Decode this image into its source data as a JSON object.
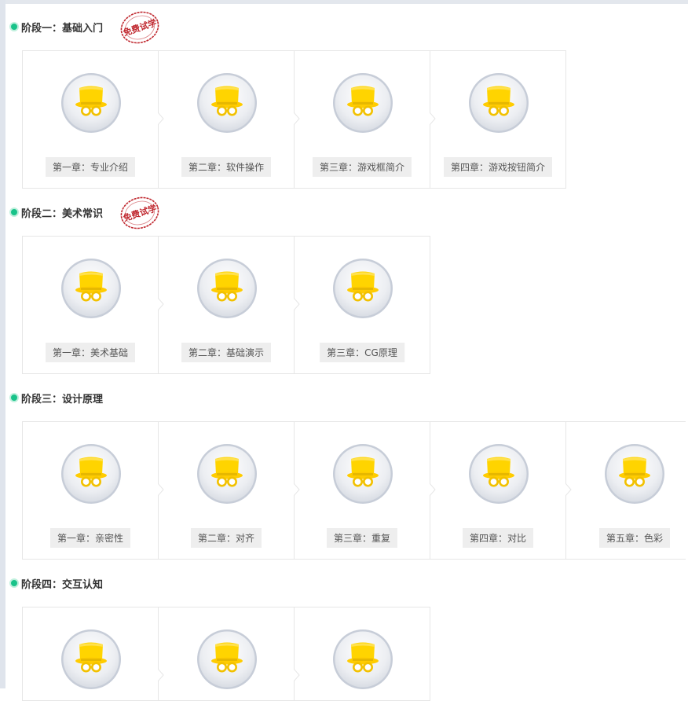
{
  "stamp_text": "免费试学",
  "stages": [
    {
      "title": "阶段一：基础入门",
      "free_trial": true,
      "chapters": [
        {
          "label": "第一章：专业介绍"
        },
        {
          "label": "第二章：软件操作"
        },
        {
          "label": "第三章：游戏框简介"
        },
        {
          "label": "第四章：游戏按钮简介"
        }
      ]
    },
    {
      "title": "阶段二：美术常识",
      "free_trial": true,
      "chapters": [
        {
          "label": "第一章：美术基础"
        },
        {
          "label": "第二章：基础演示"
        },
        {
          "label": "第三章：CG原理"
        }
      ]
    },
    {
      "title": "阶段三：设计原理",
      "free_trial": false,
      "chapters": [
        {
          "label": "第一章：亲密性"
        },
        {
          "label": "第二章：对齐"
        },
        {
          "label": "第三章：重复"
        },
        {
          "label": "第四章：对比"
        },
        {
          "label": "第五章：色彩"
        }
      ]
    },
    {
      "title": "阶段四：交互认知",
      "free_trial": false,
      "chapters": [
        {
          "label": ""
        },
        {
          "label": ""
        },
        {
          "label": ""
        }
      ]
    }
  ],
  "icons": {
    "chapter_icon": "top-hat-glasses-icon",
    "stage_marker": "green-dot-icon",
    "stamp": "free-trial-stamp-icon"
  },
  "colors": {
    "accent_green": "#19c38a",
    "hat_yellow": "#ffd400",
    "stamp_red": "#c0282f",
    "label_bg": "#eeeeee",
    "border": "#e6e6e6"
  }
}
